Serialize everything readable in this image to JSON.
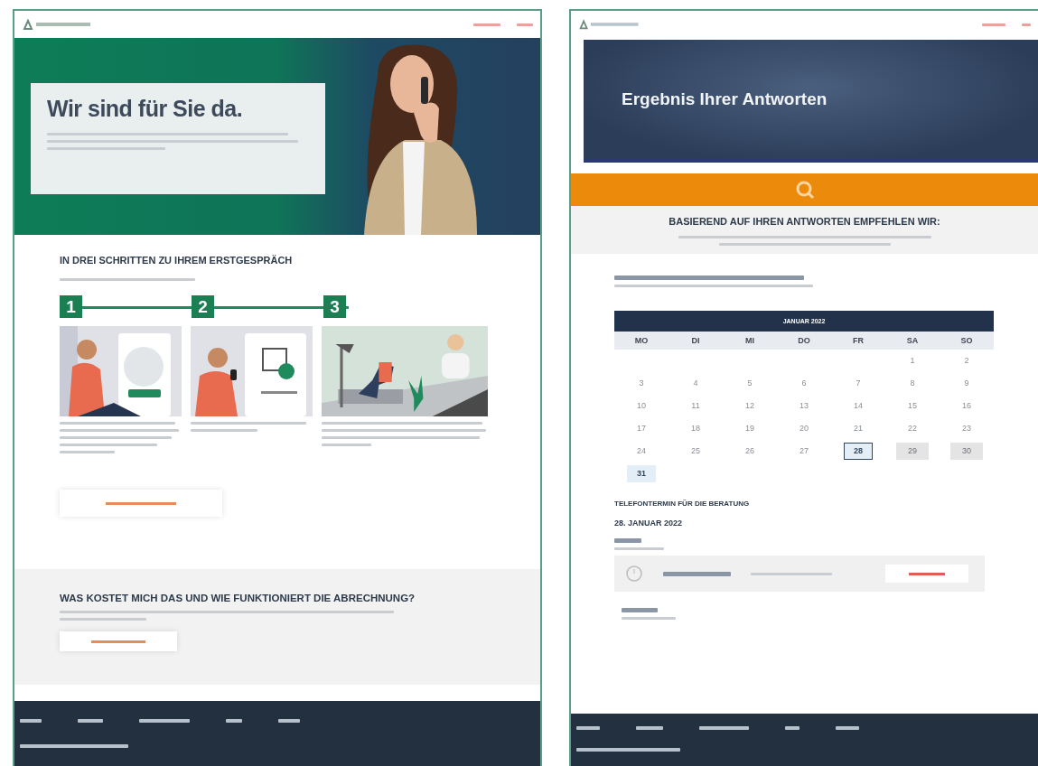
{
  "left_page": {
    "hero": {
      "title": "Wir sind für Sie da."
    },
    "steps_section": {
      "title": "IN DREI SCHRITTEN ZU IHREM ERSTGESPRÄCH",
      "steps": [
        {
          "number": "1"
        },
        {
          "number": "2"
        },
        {
          "number": "3"
        }
      ]
    },
    "cost_section": {
      "title": "WAS KOSTET MICH DAS UND WIE FUNKTIONIERT DIE ABRECHNUNG?"
    }
  },
  "right_page": {
    "hero": {
      "title": "Ergebnis Ihrer Antworten"
    },
    "recommendation": {
      "title": "BASIEREND AUF IHREN ANTWORTEN EMPFEHLEN WIR:"
    },
    "calendar": {
      "month": "JANUAR 2022",
      "weekdays": [
        "MO",
        "DI",
        "MI",
        "DO",
        "FR",
        "SA",
        "SO"
      ],
      "weeks": [
        [
          {
            "kind": "empty"
          },
          {
            "kind": "empty"
          },
          {
            "kind": "empty"
          },
          {
            "kind": "empty"
          },
          {
            "kind": "empty"
          },
          {
            "kind": "past",
            "day": "1",
            "selected": false
          },
          {
            "kind": "past",
            "day": "2",
            "selected": false
          }
        ],
        [
          {
            "kind": "past",
            "day": "3",
            "selected": false
          },
          {
            "kind": "past",
            "day": "4",
            "selected": false
          },
          {
            "kind": "past",
            "day": "5",
            "selected": false
          },
          {
            "kind": "past",
            "day": "6",
            "selected": false
          },
          {
            "kind": "past",
            "day": "7",
            "selected": false
          },
          {
            "kind": "past",
            "day": "8",
            "selected": false
          },
          {
            "kind": "past",
            "day": "9",
            "selected": false
          }
        ],
        [
          {
            "kind": "past",
            "day": "10",
            "selected": false
          },
          {
            "kind": "past",
            "day": "11",
            "selected": false
          },
          {
            "kind": "past",
            "day": "12",
            "selected": false
          },
          {
            "kind": "past",
            "day": "13",
            "selected": false
          },
          {
            "kind": "past",
            "day": "14",
            "selected": false
          },
          {
            "kind": "past",
            "day": "15",
            "selected": false
          },
          {
            "kind": "past",
            "day": "16",
            "selected": false
          }
        ],
        [
          {
            "kind": "past",
            "day": "17",
            "selected": false
          },
          {
            "kind": "past",
            "day": "18",
            "selected": false
          },
          {
            "kind": "past",
            "day": "19",
            "selected": false
          },
          {
            "kind": "past",
            "day": "20",
            "selected": false
          },
          {
            "kind": "past",
            "day": "21",
            "selected": false
          },
          {
            "kind": "past",
            "day": "22",
            "selected": false
          },
          {
            "kind": "past",
            "day": "23",
            "selected": false
          }
        ],
        [
          {
            "kind": "past",
            "day": "24",
            "selected": false
          },
          {
            "kind": "past",
            "day": "25",
            "selected": false
          },
          {
            "kind": "past",
            "day": "26",
            "selected": false
          },
          {
            "kind": "past",
            "day": "27",
            "selected": false
          },
          {
            "kind": "available",
            "day": "28",
            "selected": true
          },
          {
            "kind": "blocked",
            "day": "29",
            "selected": false
          },
          {
            "kind": "blocked",
            "day": "30",
            "selected": false
          }
        ],
        [
          {
            "kind": "available",
            "day": "31",
            "selected": false
          },
          {
            "kind": "empty"
          },
          {
            "kind": "empty"
          },
          {
            "kind": "empty"
          },
          {
            "kind": "empty"
          },
          {
            "kind": "empty"
          },
          {
            "kind": "empty"
          }
        ]
      ]
    },
    "appointment": {
      "heading": "TELEFONTERMIN FÜR DIE BERATUNG",
      "date": "28. JANUAR 2022"
    }
  }
}
